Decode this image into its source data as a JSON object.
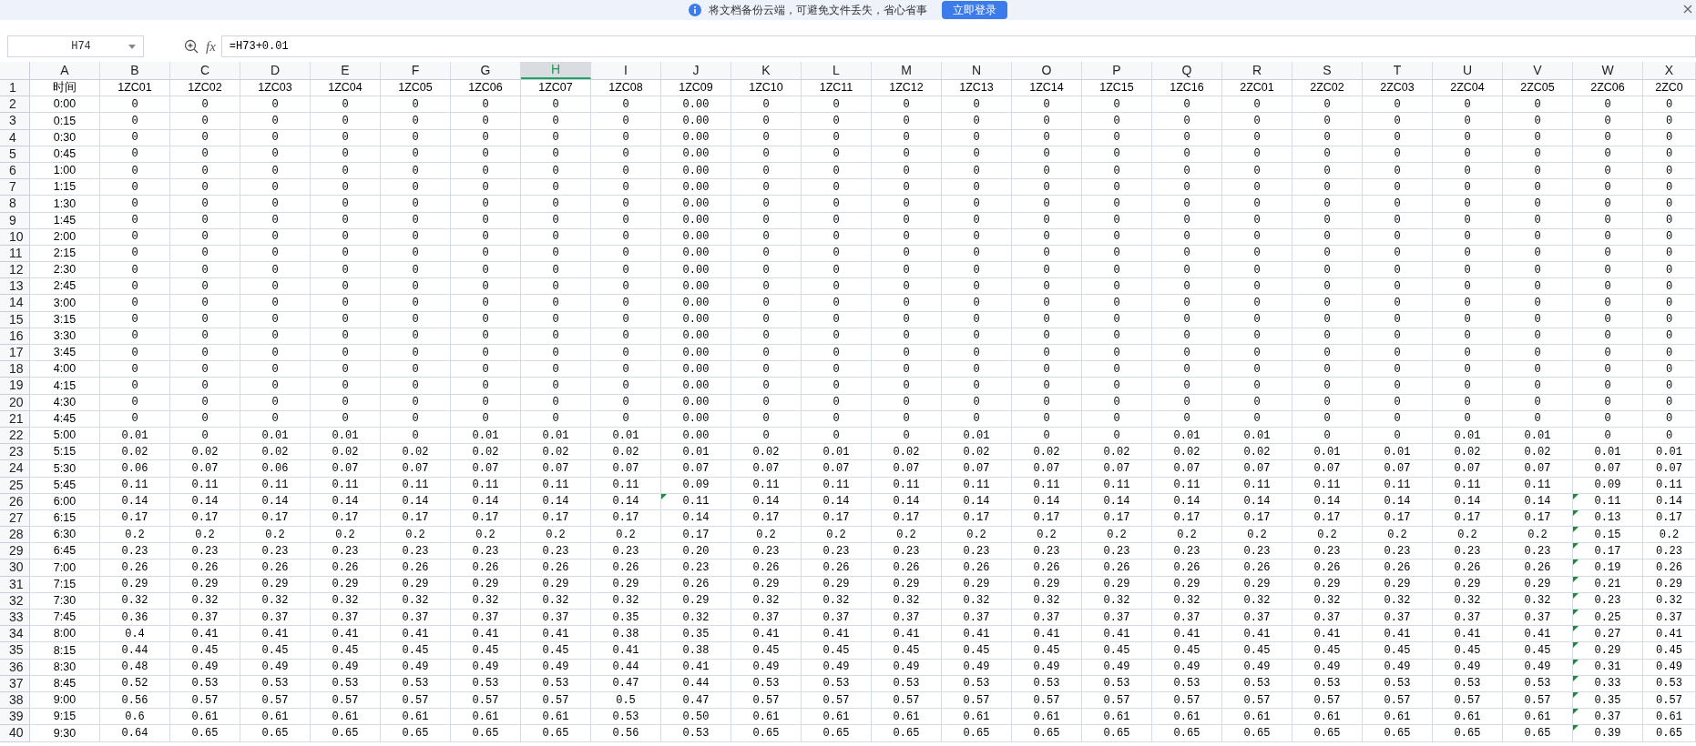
{
  "banner": {
    "message": "将文档备份云端，可避免文件丢失，省心省事",
    "button": "立即登录"
  },
  "formula_bar": {
    "name_box": "H74",
    "fx_label": "fx",
    "formula": "=H73+0.01"
  },
  "columns": [
    {
      "letter": "A",
      "selected": false
    },
    {
      "letter": "B",
      "selected": false
    },
    {
      "letter": "C",
      "selected": false
    },
    {
      "letter": "D",
      "selected": false
    },
    {
      "letter": "E",
      "selected": false
    },
    {
      "letter": "F",
      "selected": false
    },
    {
      "letter": "G",
      "selected": false
    },
    {
      "letter": "H",
      "selected": true
    },
    {
      "letter": "I",
      "selected": false
    },
    {
      "letter": "J",
      "selected": false
    },
    {
      "letter": "K",
      "selected": false
    },
    {
      "letter": "L",
      "selected": false
    },
    {
      "letter": "M",
      "selected": false
    },
    {
      "letter": "N",
      "selected": false
    },
    {
      "letter": "O",
      "selected": false
    },
    {
      "letter": "P",
      "selected": false
    },
    {
      "letter": "Q",
      "selected": false
    },
    {
      "letter": "R",
      "selected": false
    },
    {
      "letter": "S",
      "selected": false
    },
    {
      "letter": "T",
      "selected": false
    },
    {
      "letter": "U",
      "selected": false
    },
    {
      "letter": "V",
      "selected": false
    },
    {
      "letter": "W",
      "selected": false
    },
    {
      "letter": "X",
      "selected": false
    }
  ],
  "rows": [
    {
      "number": "1",
      "cells": [
        "时间",
        "1ZC01",
        "1ZC02",
        "1ZC03",
        "1ZC04",
        "1ZC05",
        "1ZC06",
        "1ZC07",
        "1ZC08",
        "1ZC09",
        "1ZC10",
        "1ZC11",
        "1ZC12",
        "1ZC13",
        "1ZC14",
        "1ZC15",
        "1ZC16",
        "2ZC01",
        "2ZC02",
        "2ZC03",
        "2ZC04",
        "2ZC05",
        "2ZC06",
        "2ZC0"
      ]
    },
    {
      "number": "2",
      "cells": [
        "0:00",
        "0",
        "0",
        "0",
        "0",
        "0",
        "0",
        "0",
        "0",
        "0.00",
        "0",
        "0",
        "0",
        "0",
        "0",
        "0",
        "0",
        "0",
        "0",
        "0",
        "0",
        "0",
        "0",
        "0"
      ]
    },
    {
      "number": "3",
      "cells": [
        "0:15",
        "0",
        "0",
        "0",
        "0",
        "0",
        "0",
        "0",
        "0",
        "0.00",
        "0",
        "0",
        "0",
        "0",
        "0",
        "0",
        "0",
        "0",
        "0",
        "0",
        "0",
        "0",
        "0",
        "0"
      ]
    },
    {
      "number": "4",
      "cells": [
        "0:30",
        "0",
        "0",
        "0",
        "0",
        "0",
        "0",
        "0",
        "0",
        "0.00",
        "0",
        "0",
        "0",
        "0",
        "0",
        "0",
        "0",
        "0",
        "0",
        "0",
        "0",
        "0",
        "0",
        "0"
      ]
    },
    {
      "number": "5",
      "cells": [
        "0:45",
        "0",
        "0",
        "0",
        "0",
        "0",
        "0",
        "0",
        "0",
        "0.00",
        "0",
        "0",
        "0",
        "0",
        "0",
        "0",
        "0",
        "0",
        "0",
        "0",
        "0",
        "0",
        "0",
        "0"
      ]
    },
    {
      "number": "6",
      "cells": [
        "1:00",
        "0",
        "0",
        "0",
        "0",
        "0",
        "0",
        "0",
        "0",
        "0.00",
        "0",
        "0",
        "0",
        "0",
        "0",
        "0",
        "0",
        "0",
        "0",
        "0",
        "0",
        "0",
        "0",
        "0"
      ]
    },
    {
      "number": "7",
      "cells": [
        "1:15",
        "0",
        "0",
        "0",
        "0",
        "0",
        "0",
        "0",
        "0",
        "0.00",
        "0",
        "0",
        "0",
        "0",
        "0",
        "0",
        "0",
        "0",
        "0",
        "0",
        "0",
        "0",
        "0",
        "0"
      ]
    },
    {
      "number": "8",
      "cells": [
        "1:30",
        "0",
        "0",
        "0",
        "0",
        "0",
        "0",
        "0",
        "0",
        "0.00",
        "0",
        "0",
        "0",
        "0",
        "0",
        "0",
        "0",
        "0",
        "0",
        "0",
        "0",
        "0",
        "0",
        "0"
      ]
    },
    {
      "number": "9",
      "cells": [
        "1:45",
        "0",
        "0",
        "0",
        "0",
        "0",
        "0",
        "0",
        "0",
        "0.00",
        "0",
        "0",
        "0",
        "0",
        "0",
        "0",
        "0",
        "0",
        "0",
        "0",
        "0",
        "0",
        "0",
        "0"
      ]
    },
    {
      "number": "10",
      "cells": [
        "2:00",
        "0",
        "0",
        "0",
        "0",
        "0",
        "0",
        "0",
        "0",
        "0.00",
        "0",
        "0",
        "0",
        "0",
        "0",
        "0",
        "0",
        "0",
        "0",
        "0",
        "0",
        "0",
        "0",
        "0"
      ]
    },
    {
      "number": "11",
      "cells": [
        "2:15",
        "0",
        "0",
        "0",
        "0",
        "0",
        "0",
        "0",
        "0",
        "0.00",
        "0",
        "0",
        "0",
        "0",
        "0",
        "0",
        "0",
        "0",
        "0",
        "0",
        "0",
        "0",
        "0",
        "0"
      ]
    },
    {
      "number": "12",
      "cells": [
        "2:30",
        "0",
        "0",
        "0",
        "0",
        "0",
        "0",
        "0",
        "0",
        "0.00",
        "0",
        "0",
        "0",
        "0",
        "0",
        "0",
        "0",
        "0",
        "0",
        "0",
        "0",
        "0",
        "0",
        "0"
      ]
    },
    {
      "number": "13",
      "cells": [
        "2:45",
        "0",
        "0",
        "0",
        "0",
        "0",
        "0",
        "0",
        "0",
        "0.00",
        "0",
        "0",
        "0",
        "0",
        "0",
        "0",
        "0",
        "0",
        "0",
        "0",
        "0",
        "0",
        "0",
        "0"
      ]
    },
    {
      "number": "14",
      "cells": [
        "3:00",
        "0",
        "0",
        "0",
        "0",
        "0",
        "0",
        "0",
        "0",
        "0.00",
        "0",
        "0",
        "0",
        "0",
        "0",
        "0",
        "0",
        "0",
        "0",
        "0",
        "0",
        "0",
        "0",
        "0"
      ]
    },
    {
      "number": "15",
      "cells": [
        "3:15",
        "0",
        "0",
        "0",
        "0",
        "0",
        "0",
        "0",
        "0",
        "0.00",
        "0",
        "0",
        "0",
        "0",
        "0",
        "0",
        "0",
        "0",
        "0",
        "0",
        "0",
        "0",
        "0",
        "0"
      ]
    },
    {
      "number": "16",
      "cells": [
        "3:30",
        "0",
        "0",
        "0",
        "0",
        "0",
        "0",
        "0",
        "0",
        "0.00",
        "0",
        "0",
        "0",
        "0",
        "0",
        "0",
        "0",
        "0",
        "0",
        "0",
        "0",
        "0",
        "0",
        "0"
      ]
    },
    {
      "number": "17",
      "cells": [
        "3:45",
        "0",
        "0",
        "0",
        "0",
        "0",
        "0",
        "0",
        "0",
        "0.00",
        "0",
        "0",
        "0",
        "0",
        "0",
        "0",
        "0",
        "0",
        "0",
        "0",
        "0",
        "0",
        "0",
        "0"
      ]
    },
    {
      "number": "18",
      "cells": [
        "4:00",
        "0",
        "0",
        "0",
        "0",
        "0",
        "0",
        "0",
        "0",
        "0.00",
        "0",
        "0",
        "0",
        "0",
        "0",
        "0",
        "0",
        "0",
        "0",
        "0",
        "0",
        "0",
        "0",
        "0"
      ]
    },
    {
      "number": "19",
      "cells": [
        "4:15",
        "0",
        "0",
        "0",
        "0",
        "0",
        "0",
        "0",
        "0",
        "0.00",
        "0",
        "0",
        "0",
        "0",
        "0",
        "0",
        "0",
        "0",
        "0",
        "0",
        "0",
        "0",
        "0",
        "0"
      ]
    },
    {
      "number": "20",
      "cells": [
        "4:30",
        "0",
        "0",
        "0",
        "0",
        "0",
        "0",
        "0",
        "0",
        "0.00",
        "0",
        "0",
        "0",
        "0",
        "0",
        "0",
        "0",
        "0",
        "0",
        "0",
        "0",
        "0",
        "0",
        "0"
      ]
    },
    {
      "number": "21",
      "cells": [
        "4:45",
        "0",
        "0",
        "0",
        "0",
        "0",
        "0",
        "0",
        "0",
        "0.00",
        "0",
        "0",
        "0",
        "0",
        "0",
        "0",
        "0",
        "0",
        "0",
        "0",
        "0",
        "0",
        "0",
        "0"
      ]
    },
    {
      "number": "22",
      "cells": [
        "5:00",
        "0.01",
        "0",
        "0.01",
        "0.01",
        "0",
        "0.01",
        "0.01",
        "0.01",
        "0.00",
        "0",
        "0",
        "0",
        "0.01",
        "0",
        "0",
        "0.01",
        "0.01",
        "0",
        "0",
        "0.01",
        "0.01",
        "0",
        "0"
      ]
    },
    {
      "number": "23",
      "cells": [
        "5:15",
        "0.02",
        "0.02",
        "0.02",
        "0.02",
        "0.02",
        "0.02",
        "0.02",
        "0.02",
        "0.01",
        "0.02",
        "0.01",
        "0.02",
        "0.02",
        "0.02",
        "0.02",
        "0.02",
        "0.02",
        "0.01",
        "0.01",
        "0.02",
        "0.02",
        "0.01",
        "0.01"
      ]
    },
    {
      "number": "24",
      "cells": [
        "5:30",
        "0.06",
        "0.07",
        "0.06",
        "0.07",
        "0.07",
        "0.07",
        "0.07",
        "0.07",
        "0.07",
        "0.07",
        "0.07",
        "0.07",
        "0.07",
        "0.07",
        "0.07",
        "0.07",
        "0.07",
        "0.07",
        "0.07",
        "0.07",
        "0.07",
        "0.07",
        "0.07"
      ]
    },
    {
      "number": "25",
      "cells": [
        "5:45",
        "0.11",
        "0.11",
        "0.11",
        "0.11",
        "0.11",
        "0.11",
        "0.11",
        "0.11",
        "0.09",
        "0.11",
        "0.11",
        "0.11",
        "0.11",
        "0.11",
        "0.11",
        "0.11",
        "0.11",
        "0.11",
        "0.11",
        "0.11",
        "0.11",
        "0.09",
        "0.11"
      ]
    },
    {
      "number": "26",
      "cells": [
        "6:00",
        "0.14",
        "0.14",
        "0.14",
        "0.14",
        "0.14",
        "0.14",
        "0.14",
        "0.14",
        {
          "value": "0.11",
          "flagged": true
        },
        "0.14",
        "0.14",
        "0.14",
        "0.14",
        "0.14",
        "0.14",
        "0.14",
        "0.14",
        "0.14",
        "0.14",
        "0.14",
        "0.14",
        {
          "value": "0.11",
          "flagged": true
        },
        "0.14"
      ]
    },
    {
      "number": "27",
      "cells": [
        "6:15",
        "0.17",
        "0.17",
        "0.17",
        "0.17",
        "0.17",
        "0.17",
        "0.17",
        "0.17",
        "0.14",
        "0.17",
        "0.17",
        "0.17",
        "0.17",
        "0.17",
        "0.17",
        "0.17",
        "0.17",
        "0.17",
        "0.17",
        "0.17",
        "0.17",
        {
          "value": "0.13",
          "flagged": true
        },
        "0.17"
      ]
    },
    {
      "number": "28",
      "cells": [
        "6:30",
        "0.2",
        "0.2",
        "0.2",
        "0.2",
        "0.2",
        "0.2",
        "0.2",
        "0.2",
        "0.17",
        "0.2",
        "0.2",
        "0.2",
        "0.2",
        "0.2",
        "0.2",
        "0.2",
        "0.2",
        "0.2",
        "0.2",
        "0.2",
        "0.2",
        {
          "value": "0.15",
          "flagged": true
        },
        "0.2"
      ]
    },
    {
      "number": "29",
      "cells": [
        "6:45",
        "0.23",
        "0.23",
        "0.23",
        "0.23",
        "0.23",
        "0.23",
        "0.23",
        "0.23",
        "0.20",
        "0.23",
        "0.23",
        "0.23",
        "0.23",
        "0.23",
        "0.23",
        "0.23",
        "0.23",
        "0.23",
        "0.23",
        "0.23",
        "0.23",
        {
          "value": "0.17",
          "flagged": true
        },
        "0.23"
      ]
    },
    {
      "number": "30",
      "cells": [
        "7:00",
        "0.26",
        "0.26",
        "0.26",
        "0.26",
        "0.26",
        "0.26",
        "0.26",
        "0.26",
        "0.23",
        "0.26",
        "0.26",
        "0.26",
        "0.26",
        "0.26",
        "0.26",
        "0.26",
        "0.26",
        "0.26",
        "0.26",
        "0.26",
        "0.26",
        {
          "value": "0.19",
          "flagged": true
        },
        "0.26"
      ]
    },
    {
      "number": "31",
      "cells": [
        "7:15",
        "0.29",
        "0.29",
        "0.29",
        "0.29",
        "0.29",
        "0.29",
        "0.29",
        "0.29",
        "0.26",
        "0.29",
        "0.29",
        "0.29",
        "0.29",
        "0.29",
        "0.29",
        "0.29",
        "0.29",
        "0.29",
        "0.29",
        "0.29",
        "0.29",
        {
          "value": "0.21",
          "flagged": true
        },
        "0.29"
      ]
    },
    {
      "number": "32",
      "cells": [
        "7:30",
        "0.32",
        "0.32",
        "0.32",
        "0.32",
        "0.32",
        "0.32",
        "0.32",
        "0.32",
        "0.29",
        "0.32",
        "0.32",
        "0.32",
        "0.32",
        "0.32",
        "0.32",
        "0.32",
        "0.32",
        "0.32",
        "0.32",
        "0.32",
        "0.32",
        {
          "value": "0.23",
          "flagged": true
        },
        "0.32"
      ]
    },
    {
      "number": "33",
      "cells": [
        "7:45",
        "0.36",
        "0.37",
        "0.37",
        "0.37",
        "0.37",
        "0.37",
        "0.37",
        "0.35",
        "0.32",
        "0.37",
        "0.37",
        "0.37",
        "0.37",
        "0.37",
        "0.37",
        "0.37",
        "0.37",
        "0.37",
        "0.37",
        "0.37",
        "0.37",
        {
          "value": "0.25",
          "flagged": true
        },
        "0.37"
      ]
    },
    {
      "number": "34",
      "cells": [
        "8:00",
        "0.4",
        "0.41",
        "0.41",
        "0.41",
        "0.41",
        "0.41",
        "0.41",
        "0.38",
        "0.35",
        "0.41",
        "0.41",
        "0.41",
        "0.41",
        "0.41",
        "0.41",
        "0.41",
        "0.41",
        "0.41",
        "0.41",
        "0.41",
        "0.41",
        {
          "value": "0.27",
          "flagged": true
        },
        "0.41"
      ]
    },
    {
      "number": "35",
      "cells": [
        "8:15",
        "0.44",
        "0.45",
        "0.45",
        "0.45",
        "0.45",
        "0.45",
        "0.45",
        "0.41",
        "0.38",
        "0.45",
        "0.45",
        "0.45",
        "0.45",
        "0.45",
        "0.45",
        "0.45",
        "0.45",
        "0.45",
        "0.45",
        "0.45",
        "0.45",
        {
          "value": "0.29",
          "flagged": true
        },
        "0.45"
      ]
    },
    {
      "number": "36",
      "cells": [
        "8:30",
        "0.48",
        "0.49",
        "0.49",
        "0.49",
        "0.49",
        "0.49",
        "0.49",
        "0.44",
        "0.41",
        "0.49",
        "0.49",
        "0.49",
        "0.49",
        "0.49",
        "0.49",
        "0.49",
        "0.49",
        "0.49",
        "0.49",
        "0.49",
        "0.49",
        {
          "value": "0.31",
          "flagged": true
        },
        "0.49"
      ]
    },
    {
      "number": "37",
      "cells": [
        "8:45",
        "0.52",
        "0.53",
        "0.53",
        "0.53",
        "0.53",
        "0.53",
        "0.53",
        "0.47",
        "0.44",
        "0.53",
        "0.53",
        "0.53",
        "0.53",
        "0.53",
        "0.53",
        "0.53",
        "0.53",
        "0.53",
        "0.53",
        "0.53",
        "0.53",
        {
          "value": "0.33",
          "flagged": true
        },
        "0.53"
      ]
    },
    {
      "number": "38",
      "cells": [
        "9:00",
        "0.56",
        "0.57",
        "0.57",
        "0.57",
        "0.57",
        "0.57",
        "0.57",
        "0.5",
        "0.47",
        "0.57",
        "0.57",
        "0.57",
        "0.57",
        "0.57",
        "0.57",
        "0.57",
        "0.57",
        "0.57",
        "0.57",
        "0.57",
        "0.57",
        {
          "value": "0.35",
          "flagged": true
        },
        "0.57"
      ]
    },
    {
      "number": "39",
      "cells": [
        "9:15",
        "0.6",
        "0.61",
        "0.61",
        "0.61",
        "0.61",
        "0.61",
        "0.61",
        "0.53",
        "0.50",
        "0.61",
        "0.61",
        "0.61",
        "0.61",
        "0.61",
        "0.61",
        "0.61",
        "0.61",
        "0.61",
        "0.61",
        "0.61",
        "0.61",
        {
          "value": "0.37",
          "flagged": true
        },
        "0.61"
      ]
    },
    {
      "number": "40",
      "cells": [
        "9:30",
        "0.64",
        "0.65",
        "0.65",
        "0.65",
        "0.65",
        "0.65",
        "0.65",
        "0.56",
        "0.53",
        "0.65",
        "0.65",
        "0.65",
        "0.65",
        "0.65",
        "0.65",
        "0.65",
        "0.65",
        "0.65",
        "0.65",
        "0.65",
        "0.65",
        {
          "value": "0.39",
          "flagged": true
        },
        "0.65"
      ]
    }
  ]
}
